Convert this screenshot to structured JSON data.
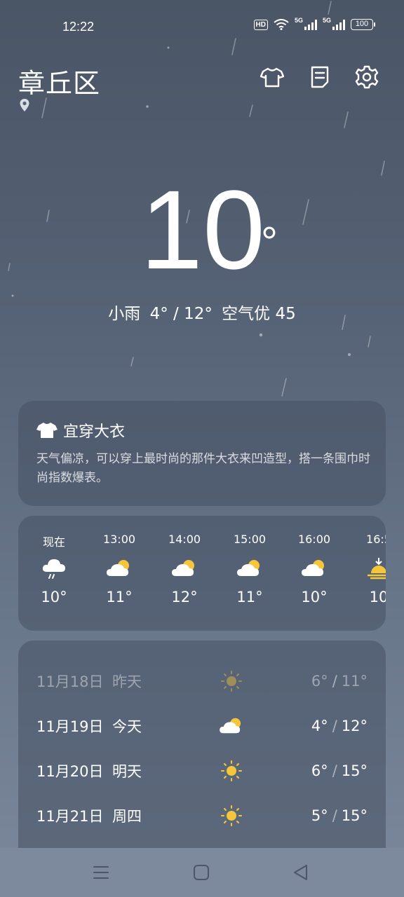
{
  "status_bar": {
    "time": "12:22",
    "hd": "HD",
    "net1": "5G",
    "net2": "5G",
    "battery": "100",
    "icons": [
      "hd-icon",
      "wifi-icon",
      "signal-icon",
      "signal-icon",
      "battery-icon"
    ]
  },
  "header": {
    "city": "章丘区",
    "buttons": [
      "shirt-icon",
      "note-icon",
      "gear-icon"
    ]
  },
  "current": {
    "temp": "10",
    "unit": "°",
    "condition": "小雨",
    "range": "4° / 12°",
    "air": "空气优 45"
  },
  "clothing": {
    "title": "宜穿大衣",
    "desc": "天气偏凉，可以穿上最时尚的那件大衣来凹造型，搭一条围巾时尚指数爆表。"
  },
  "hourly": [
    {
      "time": "现在",
      "icon": "rain-cloud-icon",
      "temp": "10°"
    },
    {
      "time": "13:00",
      "icon": "partly-cloudy-icon",
      "temp": "11°"
    },
    {
      "time": "14:00",
      "icon": "partly-cloudy-icon",
      "temp": "12°"
    },
    {
      "time": "15:00",
      "icon": "partly-cloudy-icon",
      "temp": "11°"
    },
    {
      "time": "16:00",
      "icon": "partly-cloudy-icon",
      "temp": "10°"
    },
    {
      "time": "16:5",
      "icon": "sunset-icon",
      "temp": "10"
    }
  ],
  "daily": [
    {
      "date": "11月18日",
      "name": "昨天",
      "icon": "sun-icon",
      "low": "6°",
      "sep": "/",
      "high": "11°",
      "past": true
    },
    {
      "date": "11月19日",
      "name": "今天",
      "icon": "partly-cloudy-icon",
      "low": "4°",
      "sep": "/",
      "high": "12°",
      "past": false
    },
    {
      "date": "11月20日",
      "name": "明天",
      "icon": "sun-icon",
      "low": "6°",
      "sep": "/",
      "high": "15°",
      "past": false
    },
    {
      "date": "11月21日",
      "name": "周四",
      "icon": "sun-icon",
      "low": "5°",
      "sep": "/",
      "high": "15°",
      "past": false
    }
  ],
  "colors": {
    "sun": "#f5c53a",
    "card": "#4a5466",
    "bg_top": "#4a5566",
    "bg_bottom": "#7c889b"
  },
  "nav": [
    "menu-icon",
    "home-square-icon",
    "back-triangle-icon"
  ]
}
